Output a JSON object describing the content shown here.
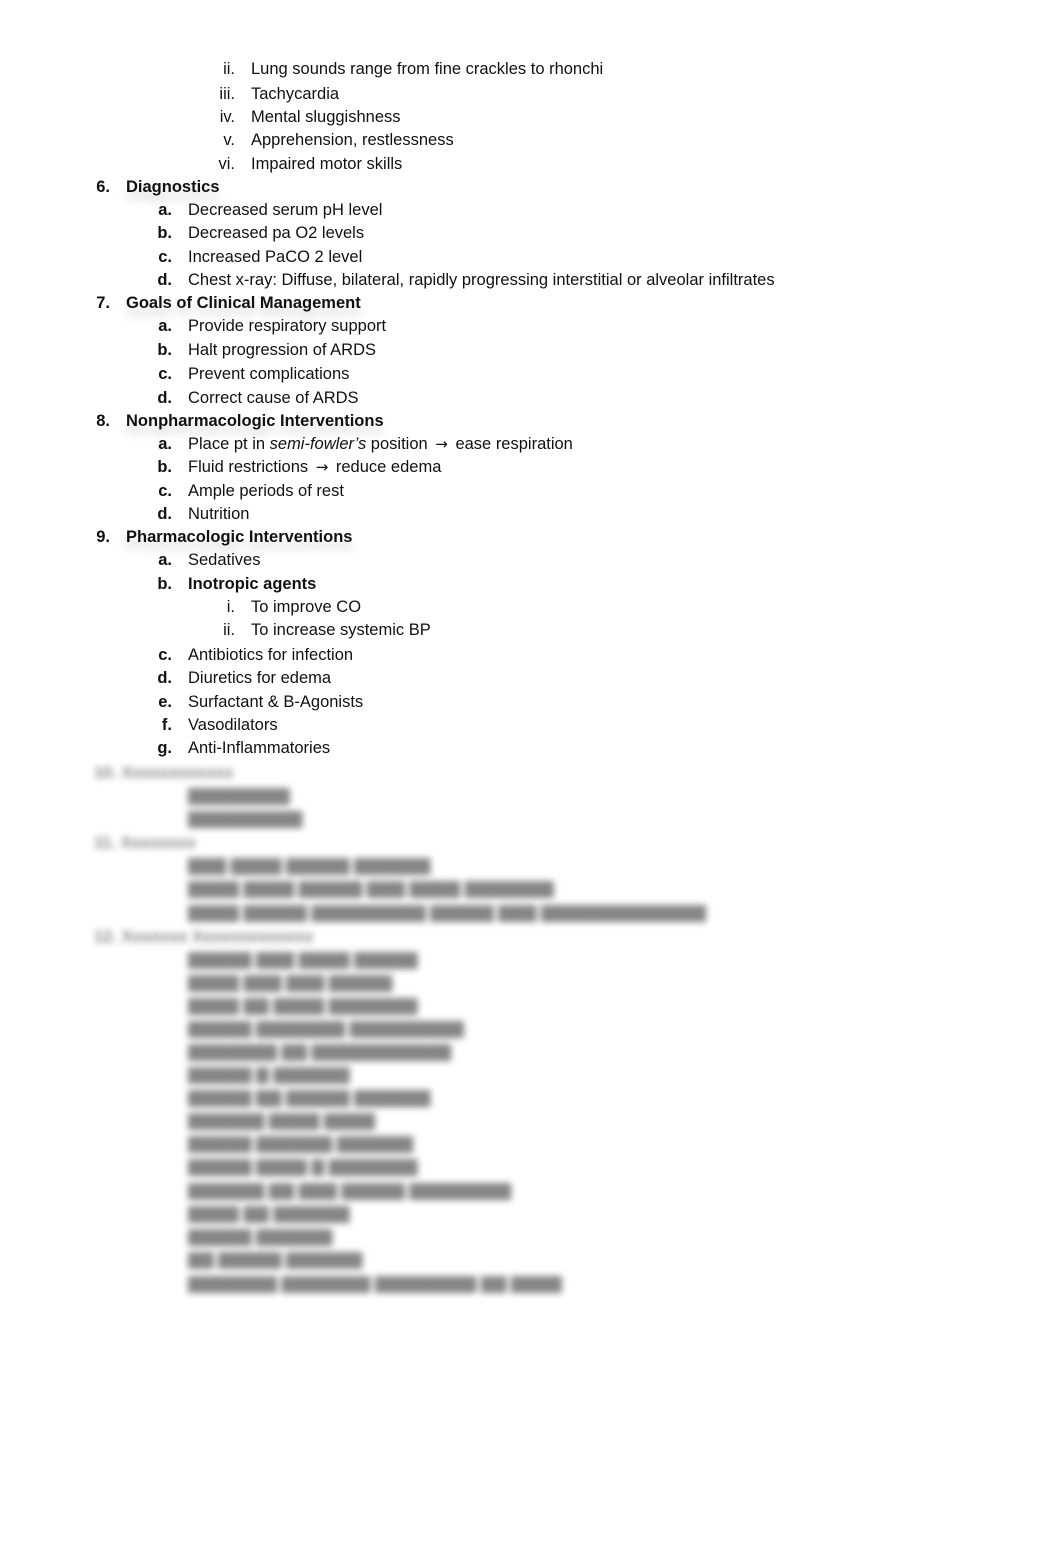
{
  "document": {
    "continued_items": [
      {
        "marker": "ii.",
        "text": "Lung sounds range from fine crackles to rhonchi"
      },
      {
        "marker": "iii.",
        "text": "Tachycardia"
      },
      {
        "marker": "iv.",
        "text": "Mental sluggishness"
      },
      {
        "marker": "v.",
        "text": "Apprehension, restlessness"
      },
      {
        "marker": "vi.",
        "text": "Impaired motor skills"
      }
    ],
    "sections": [
      {
        "number": "6.",
        "title": "Diagnostics",
        "items": [
          {
            "marker": "a.",
            "text": "Decreased serum pH level"
          },
          {
            "marker": "b.",
            "text": "Decreased pa O2 levels"
          },
          {
            "marker": "c.",
            "text": "Increased PaCO 2 level"
          },
          {
            "marker": "d.",
            "text": "Chest x-ray: Diffuse, bilateral, rapidly progressing interstitial or alveolar infiltrates"
          }
        ]
      },
      {
        "number": "7.",
        "title": "Goals of Clinical Management",
        "items": [
          {
            "marker": "a.",
            "text": "Provide respiratory support"
          },
          {
            "marker": "b.",
            "text": "Halt progression of ARDS"
          },
          {
            "marker": "c.",
            "text": "Prevent complications"
          },
          {
            "marker": "d.",
            "text": "Correct cause of ARDS"
          }
        ]
      },
      {
        "number": "8.",
        "title": "Nonpharmacologic Interventions",
        "items": [
          {
            "marker": "a.",
            "text_pre": "Place pt in ",
            "text_italic": "semi-fowler’s",
            "text_mid": " position",
            "arrow": "→",
            "text_post": "ease respiration"
          },
          {
            "marker": "b.",
            "text_pre": "Fluid restrictions",
            "arrow": "→",
            "text_post": "reduce edema"
          },
          {
            "marker": "c.",
            "text": "Ample periods of rest"
          },
          {
            "marker": "d.",
            "text": "Nutrition"
          }
        ]
      },
      {
        "number": "9.",
        "title": "Pharmacologic Interventions",
        "items": [
          {
            "marker": "a.",
            "text": "Sedatives"
          },
          {
            "marker": "b.",
            "text": "Inotropic agents",
            "bold": true,
            "subitems": [
              {
                "marker": "i.",
                "text": "To improve CO"
              },
              {
                "marker": "ii.",
                "text": "To increase systemic BP"
              }
            ]
          },
          {
            "marker": "c.",
            "text": "Antibiotics for infection"
          },
          {
            "marker": "d.",
            "text": "Diuretics for edema"
          },
          {
            "marker": "e.",
            "text": "Surfactant & B-Agonists"
          },
          {
            "marker": "f.",
            "text": "Vasodilators"
          },
          {
            "marker": "g.",
            "text": "Anti-Inflammatories"
          }
        ]
      }
    ],
    "blurred_preview": {
      "note": "Remaining content obscured (blurred)",
      "placeholder_heading_a": "10. Xxxxxxxxxxxx",
      "placeholder_heading_b": "11. Xxxxxxxx",
      "placeholder_heading_c": "12. Xxxxxxx Xxxxxxxxxxxxx"
    }
  }
}
